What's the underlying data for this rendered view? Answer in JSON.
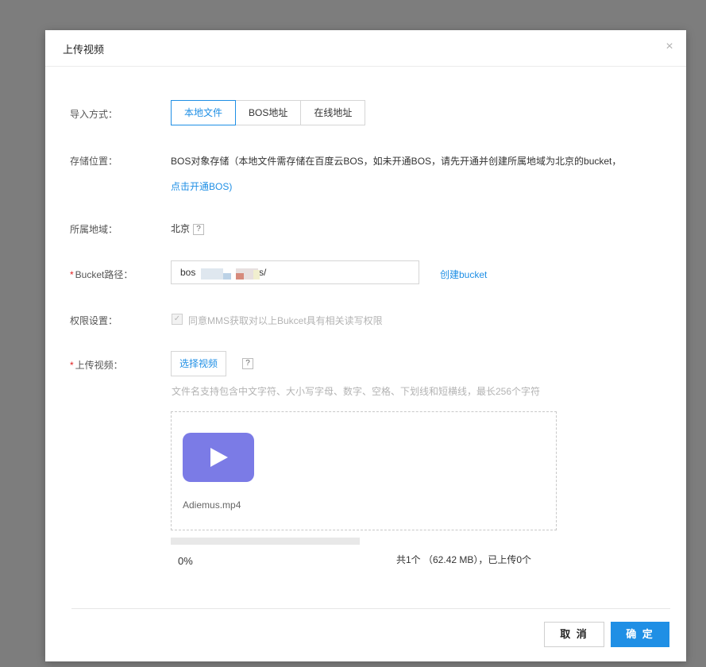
{
  "dialog": {
    "title": "上传视频",
    "close_glyph": "×"
  },
  "import": {
    "label": "导入方式：",
    "options": [
      "本地文件",
      "BOS地址",
      "在线地址"
    ],
    "selected": "本地文件"
  },
  "storage": {
    "label": "存储位置：",
    "text": "BOS对象存储（本地文件需存储在百度云BOS，如未开通BOS，请先开通并创建所属地域为北京的bucket，",
    "link": "点击开通BOS",
    "suffix": ")"
  },
  "region": {
    "label": "所属地域：",
    "value": "北京",
    "help": "?"
  },
  "bucket": {
    "required": "*",
    "label": "Bucket路径：",
    "value_prefix": "bos",
    "value_suffix": "s/",
    "create_link": "创建bucket"
  },
  "permission": {
    "label": "权限设置：",
    "check_glyph": "✓",
    "text": "同意MMS获取对以上Bukcet具有相关读写权限"
  },
  "upload": {
    "required": "*",
    "label": "上传视频：",
    "select_button": "选择视频",
    "help": "?",
    "hint": "文件名支持包含中文字符、大小写字母、数字、空格、下划线和短横线，最长256个字符",
    "file_name": "Adiemus.mp4",
    "thumb_icon": "play-icon",
    "progress_percent": 0,
    "progress_text": "0%",
    "summary": "共1个 （62.42 MB），已上传0个"
  },
  "footer": {
    "cancel": "取 消",
    "confirm": "确 定"
  },
  "colors": {
    "accent": "#1f8fe5",
    "thumb": "#7b7be6",
    "required": "#e02020"
  }
}
